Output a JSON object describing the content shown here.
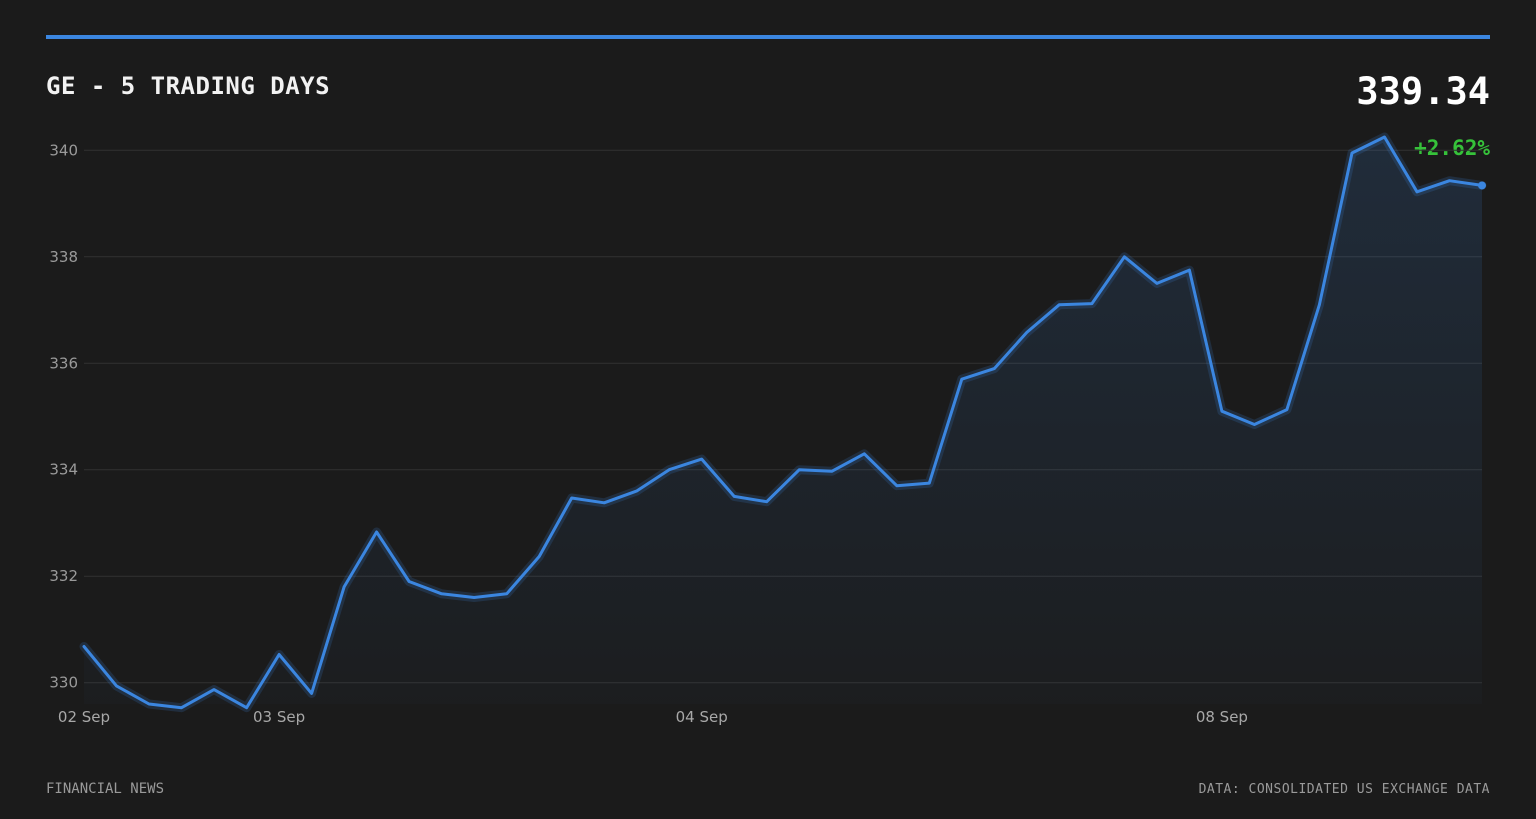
{
  "header": {
    "title": "GE - 5 TRADING DAYS",
    "price": "339.34",
    "change": "+2.62%"
  },
  "footer": {
    "left": "FINANCIAL NEWS",
    "right": "DATA: CONSOLIDATED US EXCHANGE DATA"
  },
  "colors": {
    "accent": "#3b86e0",
    "positive": "#36c23a",
    "background": "#1b1b1b"
  },
  "chart_data": {
    "type": "area",
    "title": "GE - 5 TRADING DAYS",
    "ylim": [
      329.6,
      340.25
    ],
    "yticks": [
      330,
      332,
      334,
      336,
      338,
      340
    ],
    "grid": true,
    "xtick_labels": [
      {
        "label": "02 Sep",
        "index": 0
      },
      {
        "label": "03 Sep",
        "index": 6
      },
      {
        "label": "04 Sep",
        "index": 19
      },
      {
        "label": "08 Sep",
        "index": 35
      }
    ],
    "series": [
      {
        "values": [
          330.68,
          329.94,
          329.6,
          329.53,
          329.87,
          329.53,
          330.53,
          329.8,
          331.8,
          332.83,
          331.9,
          331.67,
          331.6,
          331.67,
          332.37,
          333.47,
          333.38,
          333.6,
          334.0,
          334.2,
          333.5,
          333.4,
          334.0,
          333.97,
          334.3,
          333.7,
          333.75,
          335.7,
          335.9,
          336.58,
          337.1,
          337.12,
          338.0,
          337.5,
          337.75,
          335.1,
          334.85,
          335.13,
          337.1,
          339.95,
          340.25,
          339.22,
          339.43,
          339.34
        ]
      }
    ]
  }
}
